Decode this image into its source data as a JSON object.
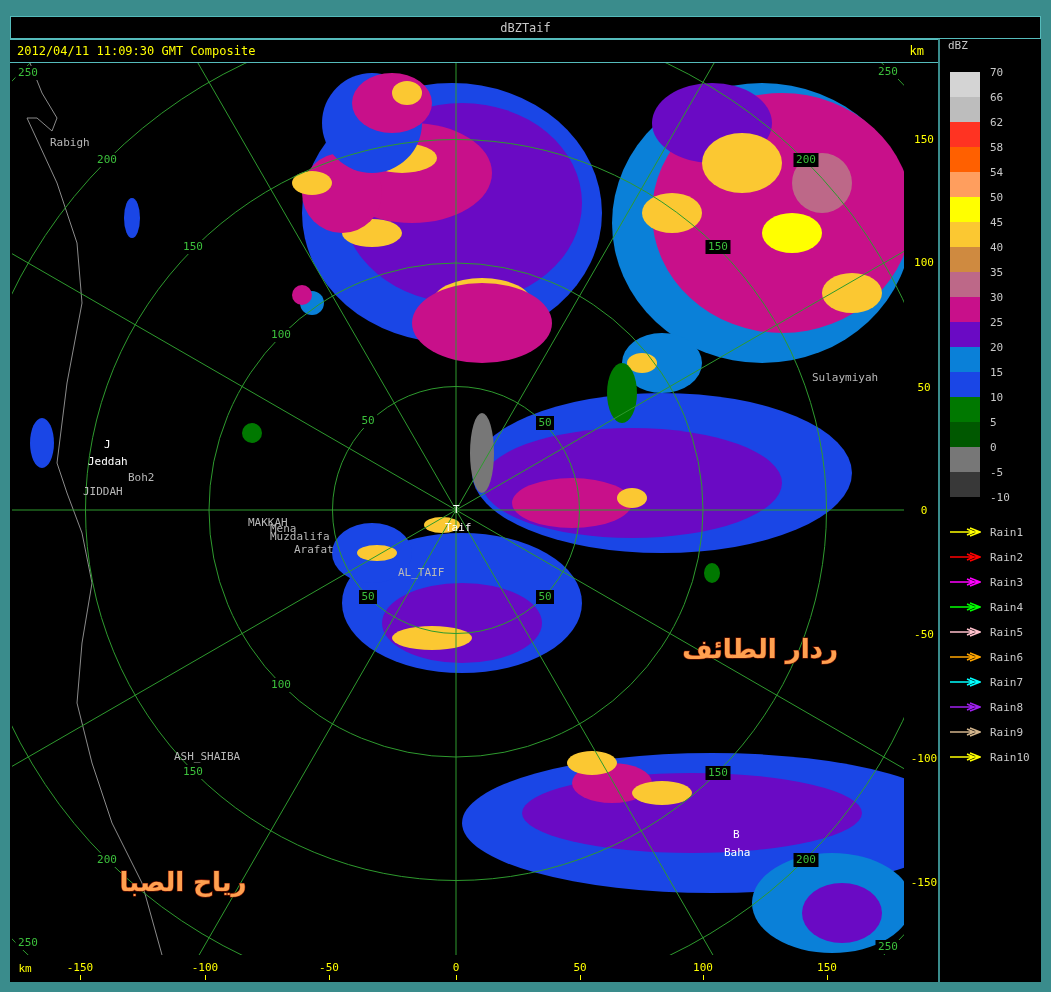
{
  "window": {
    "title": "dBZTaif"
  },
  "header": {
    "timestamp": "2012/04/11 11:09:30 GMT Composite",
    "unit": "km"
  },
  "map": {
    "ring_labels": [
      "250",
      "200",
      "150",
      "100",
      "50",
      "50",
      "150",
      "200",
      "250",
      "50",
      "50",
      "100",
      "150",
      "200",
      "150",
      "200",
      "250",
      "250"
    ],
    "places": [
      {
        "name": "Rabigh",
        "kind": "place"
      },
      {
        "name": "J",
        "kind": "station"
      },
      {
        "name": "Jeddah",
        "kind": "station"
      },
      {
        "name": "Boh2",
        "kind": "place"
      },
      {
        "name": "JIDDAH",
        "kind": "place"
      },
      {
        "name": "MAKKAH",
        "kind": "place"
      },
      {
        "name": "Mena",
        "kind": "place"
      },
      {
        "name": "Muzdalifa",
        "kind": "place"
      },
      {
        "name": "Arafat",
        "kind": "place"
      },
      {
        "name": "T",
        "kind": "station"
      },
      {
        "name": "Taif",
        "kind": "station"
      },
      {
        "name": "AL_TAIF",
        "kind": "place"
      },
      {
        "name": "Sulaymiyah",
        "kind": "place"
      },
      {
        "name": "ASH_SHAIBA",
        "kind": "place"
      },
      {
        "name": "B",
        "kind": "station"
      },
      {
        "name": "Baha",
        "kind": "station"
      }
    ],
    "overlay_texts": [
      "ردار الطائف",
      "رياح الصبا"
    ]
  },
  "y_axis": {
    "labels": [
      "150",
      "100",
      "50",
      "0",
      "-50",
      "-100",
      "-150"
    ]
  },
  "x_axis": {
    "unit": "km",
    "labels": [
      "-150",
      "-100",
      "-50",
      "0",
      "50",
      "100",
      "150"
    ]
  },
  "legend": {
    "title": "dBZ",
    "swatches": [
      {
        "color": "#d4d4d4"
      },
      {
        "color": "#bdbdbd"
      },
      {
        "color": "#ff3322"
      },
      {
        "color": "#ff6000"
      },
      {
        "color": "#ff9e5e"
      },
      {
        "color": "#ffff00"
      },
      {
        "color": "#fbc832"
      },
      {
        "color": "#cf8a40"
      },
      {
        "color": "#bd6888"
      },
      {
        "color": "#c8108a"
      },
      {
        "color": "#6a0ac4"
      },
      {
        "color": "#0a80d8"
      },
      {
        "color": "#1a46e6"
      },
      {
        "color": "#007800"
      },
      {
        "color": "#005800"
      },
      {
        "color": "#777777"
      },
      {
        "color": "#383838"
      }
    ],
    "labels": [
      "70",
      "66",
      "62",
      "58",
      "54",
      "50",
      "45",
      "40",
      "35",
      "30",
      "25",
      "20",
      "15",
      "10",
      "5",
      "0",
      "-5",
      "-10"
    ]
  },
  "tracks": [
    {
      "name": "Rain1",
      "color": "#ffff00"
    },
    {
      "name": "Rain2",
      "color": "#ff0000"
    },
    {
      "name": "Rain3",
      "color": "#ff00ff"
    },
    {
      "name": "Rain4",
      "color": "#00ff00"
    },
    {
      "name": "Rain5",
      "color": "#ffc0cb"
    },
    {
      "name": "Rain6",
      "color": "#ffa500"
    },
    {
      "name": "Rain7",
      "color": "#00ffff"
    },
    {
      "name": "Rain8",
      "color": "#a020f0"
    },
    {
      "name": "Rain9",
      "color": "#d2b48c"
    },
    {
      "name": "Rain10",
      "color": "#ffff00"
    }
  ]
}
